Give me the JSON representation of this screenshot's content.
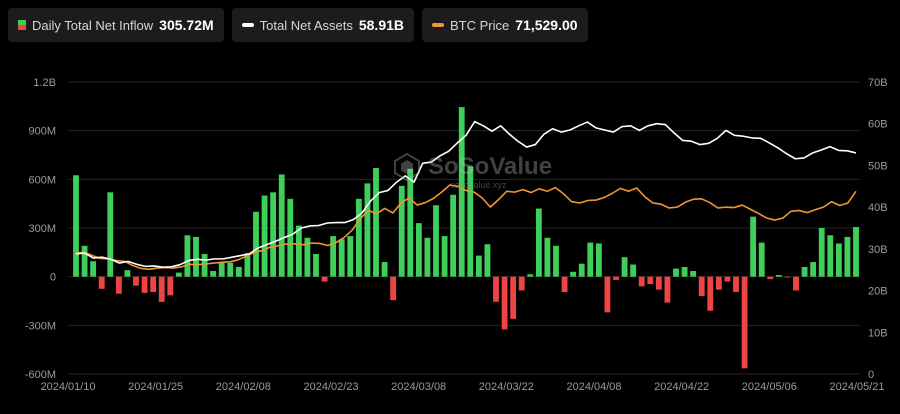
{
  "legend": {
    "inflow_label": "Daily Total Net Inflow",
    "inflow_value": "305.72M",
    "assets_label": "Total Net Assets",
    "assets_value": "58.91B",
    "btc_label": "BTC Price",
    "btc_value": "71,529.00"
  },
  "watermark": {
    "brand": "SoSoValue",
    "url": "sosovalue.xyz"
  },
  "colors": {
    "positive": "#3ecf5a",
    "negative": "#ef4444",
    "assets_line": "#ffffff",
    "btc_line": "#f0962e",
    "background": "#000000",
    "grid": "#262626",
    "axis_text": "#9a9a9a"
  },
  "chart_data": {
    "type": "bar",
    "title": "",
    "x_ticks": [
      "2024/01/10",
      "2024/01/25",
      "2024/02/08",
      "2024/02/23",
      "2024/03/08",
      "2024/03/22",
      "2024/04/08",
      "2024/04/22",
      "2024/05/06",
      "2024/05/21"
    ],
    "left_axis": {
      "ticks": [
        "-600M",
        "-300M",
        "0",
        "300M",
        "600M",
        "900M",
        "1.2B"
      ],
      "ylim": [
        -600,
        1200
      ],
      "unit": "M"
    },
    "right_axis": {
      "ticks": [
        "0",
        "10B",
        "20B",
        "30B",
        "40B",
        "50B",
        "60B",
        "70B"
      ],
      "ylim": [
        0,
        70
      ],
      "unit": "B"
    },
    "grid": true,
    "series": [
      {
        "name": "Daily Total Net Inflow",
        "kind": "bar",
        "axis": "left",
        "values": [
          625,
          190,
          95,
          -75,
          520,
          -105,
          40,
          -55,
          -100,
          -95,
          -155,
          -115,
          25,
          255,
          245,
          140,
          35,
          85,
          85,
          60,
          145,
          400,
          500,
          520,
          630,
          480,
          315,
          240,
          140,
          -30,
          250,
          230,
          250,
          480,
          575,
          670,
          90,
          -145,
          560,
          665,
          330,
          240,
          440,
          250,
          505,
          1045,
          680,
          130,
          200,
          -155,
          -325,
          -260,
          -85,
          15,
          420,
          240,
          190,
          -95,
          30,
          80,
          210,
          205,
          -220,
          -20,
          120,
          75,
          -60,
          -45,
          -80,
          -160,
          50,
          60,
          35,
          -120,
          -210,
          -80,
          -30,
          -95,
          -565,
          370,
          210,
          -15,
          10,
          -5,
          -85,
          60,
          90,
          300,
          255,
          205,
          245,
          306
        ]
      },
      {
        "name": "Total Net Assets",
        "kind": "line",
        "axis": "right",
        "values": [
          28.8,
          29.0,
          27.8,
          28.0,
          27.5,
          26.6,
          27.0,
          26.3,
          25.8,
          25.9,
          25.6,
          25.7,
          26.2,
          27.2,
          27.5,
          27.3,
          27.6,
          27.6,
          28.0,
          28.4,
          28.8,
          30.2,
          31.0,
          31.8,
          32.7,
          33.5,
          35.0,
          35.5,
          35.6,
          36.2,
          36.3,
          36.3,
          37.0,
          38.6,
          41.5,
          43.5,
          44.0,
          46.0,
          47.5,
          46.0,
          50.5,
          50.8,
          52.3,
          53.4,
          55.4,
          57.2,
          60.5,
          59.5,
          58.2,
          59.5,
          57.5,
          55.8,
          54.4,
          55.0,
          57.5,
          58.8,
          58.0,
          58.5,
          59.5,
          60.4,
          59.0,
          58.5,
          58.0,
          59.3,
          59.5,
          58.4,
          59.5,
          60.0,
          59.8,
          57.8,
          56.0,
          55.8,
          55.0,
          55.3,
          56.5,
          58.4,
          57.2,
          57.0,
          56.6,
          56.5,
          55.4,
          54.2,
          52.8,
          51.6,
          51.8,
          53.0,
          53.7,
          54.5,
          53.6,
          53.5,
          53.0
        ]
      },
      {
        "name": "BTC Price",
        "kind": "line",
        "axis": "right",
        "values": [
          29.0,
          29.2,
          28.4,
          27.7,
          27.6,
          27.2,
          27.0,
          26.0,
          25.3,
          25.1,
          25.4,
          25.5,
          25.4,
          25.7,
          26.3,
          26.2,
          26.4,
          26.6,
          26.8,
          26.9,
          27.4,
          28.3,
          29.2,
          29.6,
          30.5,
          30.8,
          31.2,
          31.2,
          31.0,
          31.4,
          31.3,
          30.8,
          31.5,
          32.7,
          34.5,
          37.3,
          39.2,
          38.4,
          39.7,
          38.6,
          41.0,
          42.2,
          40.5,
          41.1,
          42.1,
          43.6,
          45.3,
          45.0,
          44.0,
          43.6,
          42.2,
          40.0,
          41.8,
          43.8,
          43.6,
          44.2,
          43.5,
          44.4,
          43.8,
          44.7,
          43.2,
          41.3,
          41.0,
          41.6,
          41.7,
          42.3,
          43.3,
          44.5,
          43.8,
          44.6,
          42.5,
          41.0,
          40.7,
          39.8,
          40.0,
          41.2,
          41.9,
          42.0,
          41.1,
          39.8,
          40.0,
          39.9,
          40.5,
          39.5,
          38.5,
          37.4,
          36.9,
          37.4,
          39.0,
          39.2,
          38.7,
          39.4,
          40.0,
          41.3,
          40.4,
          41.0,
          43.8
        ]
      }
    ]
  }
}
